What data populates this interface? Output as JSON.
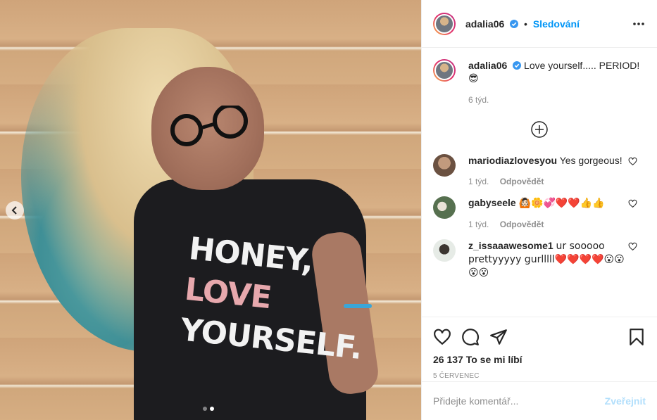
{
  "post": {
    "username": "adalia06",
    "follow_label": "Sledování",
    "separator": "•",
    "photo": {
      "shirt_line1": "HONEY,",
      "shirt_line2": "LOVE",
      "shirt_line3": "YOURSELF."
    }
  },
  "caption": {
    "username": "adalia06",
    "text": "Love yourself..... PERIOD!",
    "emoji": "😎",
    "time": "6 týd."
  },
  "comments": [
    {
      "username": "mariodiazlovesyou",
      "text": "Yes gorgeous!",
      "time": "1 týd.",
      "reply_label": "Odpovědět",
      "avatar_color": "#b08a6e"
    },
    {
      "username": "gabyseele",
      "text": "🙆🏻🌼💞❤️❤️👍👍",
      "time": "1 týd.",
      "reply_label": "Odpovědět",
      "avatar_color": "#6e8a6a"
    },
    {
      "username": "z_issaaawesome1",
      "text": "ur sooooo prettyyyyy gurlllll❤️❤️❤️❤️😮😮😮😮",
      "time": "",
      "reply_label": "",
      "avatar_color": "#dde3e0"
    }
  ],
  "actions": {
    "likes": "26 137 To se mi líbí",
    "date": "5 ČERVENEC"
  },
  "composer": {
    "placeholder": "Přidejte komentář...",
    "publish_label": "Zveřejnit"
  },
  "colors": {
    "link_blue": "#0095f6",
    "muted": "#8e8e8e",
    "publish_disabled": "#b2dffc"
  }
}
